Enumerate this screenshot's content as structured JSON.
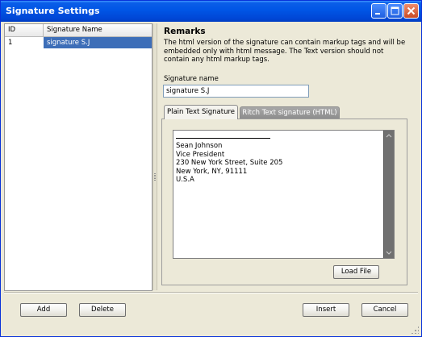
{
  "window": {
    "title": "Signature Settings"
  },
  "table": {
    "columns": [
      "ID",
      "Signature Name"
    ],
    "rows": [
      {
        "id": "1",
        "name": "signature S.J"
      }
    ]
  },
  "remarks": {
    "title": "Remarks",
    "text": "The html version of the signature can contain markup tags and will be embedded only with html message. The Text version should not contain any html markup tags."
  },
  "signature_name": {
    "label": "Signature name",
    "value": "signature S.J"
  },
  "tabs": [
    {
      "label": "Plain Text Signature",
      "active": true
    },
    {
      "label": "Ritch Text signature (HTML)",
      "active": false
    }
  ],
  "signature_text": {
    "separator": "____________________",
    "lines": [
      "Sean Johnson",
      "Vice President",
      "230 New York Street, Suite 205",
      "New York, NY, 91111",
      "U.S.A"
    ]
  },
  "buttons": {
    "load_file": "Load File",
    "add": "Add",
    "delete": "Delete",
    "insert": "Insert",
    "cancel": "Cancel"
  },
  "colors": {
    "titlebar": "#0055e5",
    "selection": "#3d6eb8"
  }
}
